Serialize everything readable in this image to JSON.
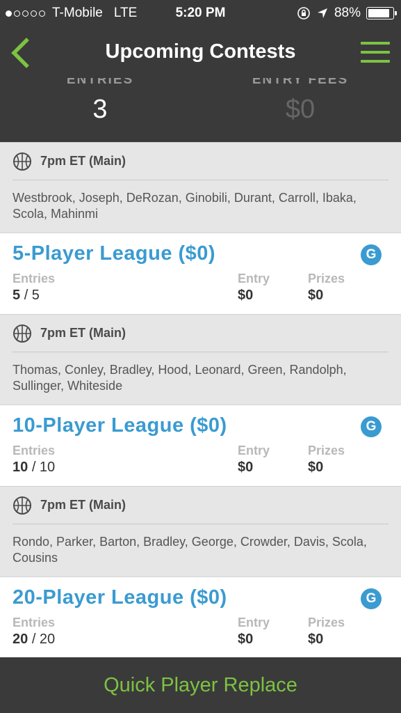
{
  "status": {
    "carrier": "T-Mobile",
    "network": "LTE",
    "time": "5:20 PM",
    "battery": "88%",
    "battery_level": 0.88
  },
  "nav": {
    "title": "Upcoming Contests"
  },
  "summary": {
    "entries_label": "ENTRIES",
    "entries_value": "3",
    "fees_label": "ENTRY FEES",
    "fees_value": "$0"
  },
  "groups": [
    {
      "slate": "7pm ET (Main)",
      "players": "Westbrook, Joseph, DeRozan, Ginobili, Durant, Carroll, Ibaka, Scola, Mahinmi",
      "contest": {
        "name": "5-Player League ($0)",
        "badge": "G",
        "entries_label": "Entries",
        "entries_current": "5",
        "entries_total": "/ 5",
        "entry_label": "Entry",
        "entry_value": "$0",
        "prizes_label": "Prizes",
        "prizes_value": "$0"
      }
    },
    {
      "slate": "7pm ET (Main)",
      "players": "Thomas, Conley, Bradley, Hood, Leonard, Green, Randolph, Sullinger, Whiteside",
      "contest": {
        "name": "10-Player League ($0)",
        "badge": "G",
        "entries_label": "Entries",
        "entries_current": "10",
        "entries_total": "/ 10",
        "entry_label": "Entry",
        "entry_value": "$0",
        "prizes_label": "Prizes",
        "prizes_value": "$0"
      }
    },
    {
      "slate": "7pm ET (Main)",
      "players": "Rondo, Parker, Barton, Bradley, George, Crowder, Davis, Scola, Cousins",
      "contest": {
        "name": "20-Player League ($0)",
        "badge": "G",
        "entries_label": "Entries",
        "entries_current": "20",
        "entries_total": "/ 20",
        "entry_label": "Entry",
        "entry_value": "$0",
        "prizes_label": "Prizes",
        "prizes_value": "$0"
      }
    }
  ],
  "footer": {
    "button_label": "Quick Player Replace"
  },
  "icons": {
    "back": "chevron-left-icon",
    "menu": "hamburger-menu-icon",
    "sport": "basketball-icon",
    "location": "location-arrow-icon",
    "lock": "rotation-lock-icon"
  },
  "colors": {
    "accent_green": "#7dc242",
    "accent_blue": "#3a9bd1",
    "header_bg": "#3a3a3a"
  }
}
